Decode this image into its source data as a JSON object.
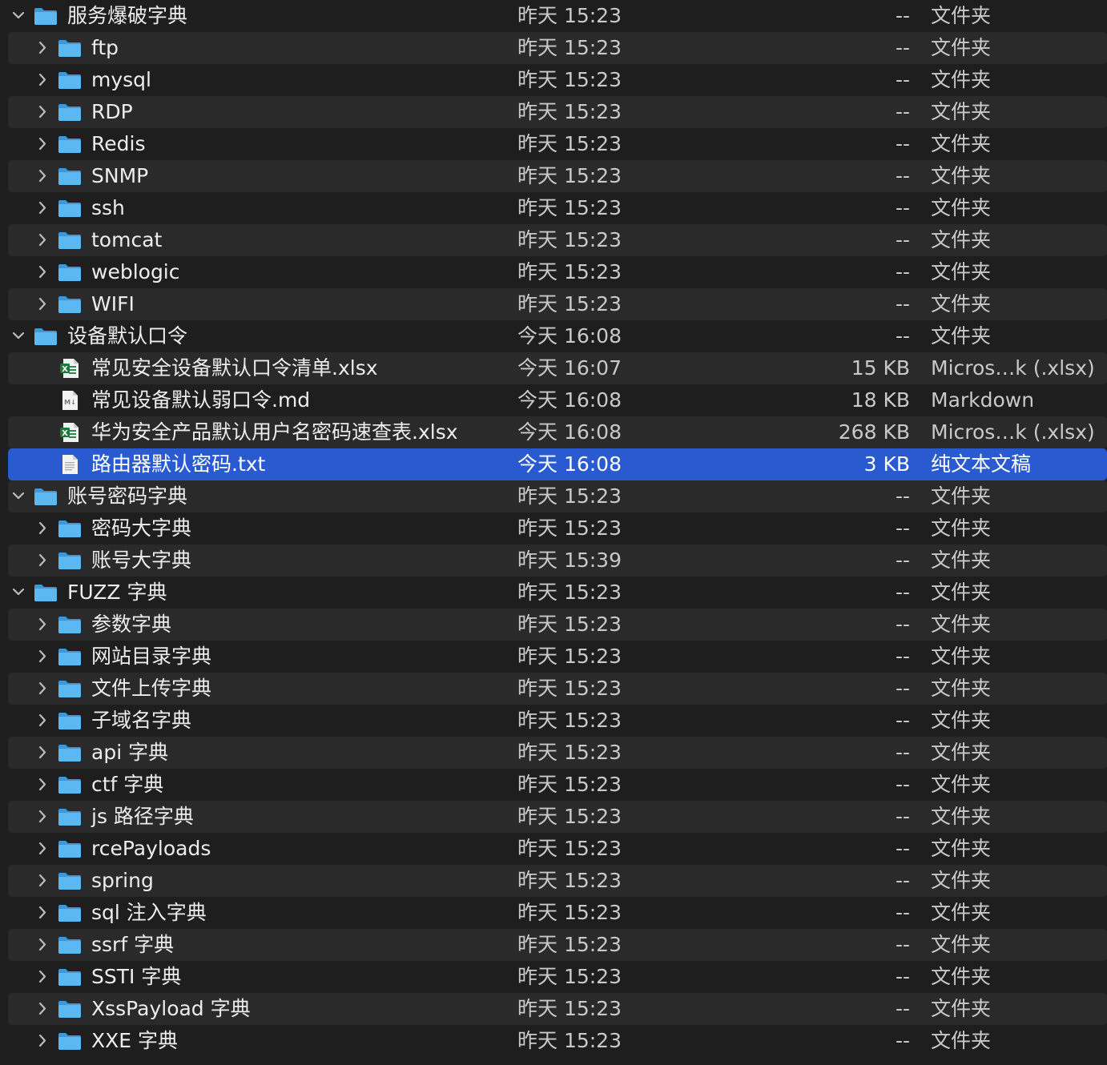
{
  "colors": {
    "background": "#1e1e1e",
    "stripe": "#2a2a2a",
    "selection": "#2a5ad0",
    "folder": "#5cb8f0",
    "excel_green": "#1e7a3c"
  },
  "rows": [
    {
      "name": "服务爆破字典",
      "date": "昨天 15:23",
      "size": "--",
      "kind": "文件夹",
      "depth": 0,
      "type": "folder",
      "expanded": true
    },
    {
      "name": "ftp",
      "date": "昨天 15:23",
      "size": "--",
      "kind": "文件夹",
      "depth": 1,
      "type": "folder",
      "expanded": false
    },
    {
      "name": "mysql",
      "date": "昨天 15:23",
      "size": "--",
      "kind": "文件夹",
      "depth": 1,
      "type": "folder",
      "expanded": false
    },
    {
      "name": "RDP",
      "date": "昨天 15:23",
      "size": "--",
      "kind": "文件夹",
      "depth": 1,
      "type": "folder",
      "expanded": false
    },
    {
      "name": "Redis",
      "date": "昨天 15:23",
      "size": "--",
      "kind": "文件夹",
      "depth": 1,
      "type": "folder",
      "expanded": false
    },
    {
      "name": "SNMP",
      "date": "昨天 15:23",
      "size": "--",
      "kind": "文件夹",
      "depth": 1,
      "type": "folder",
      "expanded": false
    },
    {
      "name": "ssh",
      "date": "昨天 15:23",
      "size": "--",
      "kind": "文件夹",
      "depth": 1,
      "type": "folder",
      "expanded": false
    },
    {
      "name": "tomcat",
      "date": "昨天 15:23",
      "size": "--",
      "kind": "文件夹",
      "depth": 1,
      "type": "folder",
      "expanded": false
    },
    {
      "name": "weblogic",
      "date": "昨天 15:23",
      "size": "--",
      "kind": "文件夹",
      "depth": 1,
      "type": "folder",
      "expanded": false
    },
    {
      "name": "WIFI",
      "date": "昨天 15:23",
      "size": "--",
      "kind": "文件夹",
      "depth": 1,
      "type": "folder",
      "expanded": false
    },
    {
      "name": "设备默认口令",
      "date": "今天 16:08",
      "size": "--",
      "kind": "文件夹",
      "depth": 0,
      "type": "folder",
      "expanded": true
    },
    {
      "name": "常见安全设备默认口令清单.xlsx",
      "date": "今天 16:07",
      "size": "15 KB",
      "kind": "Micros…k (.xlsx)",
      "depth": 1,
      "type": "xlsx"
    },
    {
      "name": "常见设备默认弱口令.md",
      "date": "今天 16:08",
      "size": "18 KB",
      "kind": "Markdown",
      "depth": 1,
      "type": "md"
    },
    {
      "name": "华为安全产品默认用户名密码速查表.xlsx",
      "date": "今天 16:08",
      "size": "268 KB",
      "kind": "Micros…k (.xlsx)",
      "depth": 1,
      "type": "xlsx"
    },
    {
      "name": "路由器默认密码.txt",
      "date": "今天 16:08",
      "size": "3 KB",
      "kind": "纯文本文稿",
      "depth": 1,
      "type": "txt",
      "selected": true
    },
    {
      "name": "账号密码字典",
      "date": "昨天 15:23",
      "size": "--",
      "kind": "文件夹",
      "depth": 0,
      "type": "folder",
      "expanded": true
    },
    {
      "name": "密码大字典",
      "date": "昨天 15:23",
      "size": "--",
      "kind": "文件夹",
      "depth": 1,
      "type": "folder",
      "expanded": false
    },
    {
      "name": "账号大字典",
      "date": "昨天 15:39",
      "size": "--",
      "kind": "文件夹",
      "depth": 1,
      "type": "folder",
      "expanded": false
    },
    {
      "name": "FUZZ 字典",
      "date": "昨天 15:23",
      "size": "--",
      "kind": "文件夹",
      "depth": 0,
      "type": "folder",
      "expanded": true
    },
    {
      "name": "参数字典",
      "date": "昨天 15:23",
      "size": "--",
      "kind": "文件夹",
      "depth": 1,
      "type": "folder",
      "expanded": false
    },
    {
      "name": "网站目录字典",
      "date": "昨天 15:23",
      "size": "--",
      "kind": "文件夹",
      "depth": 1,
      "type": "folder",
      "expanded": false
    },
    {
      "name": "文件上传字典",
      "date": "昨天 15:23",
      "size": "--",
      "kind": "文件夹",
      "depth": 1,
      "type": "folder",
      "expanded": false
    },
    {
      "name": "子域名字典",
      "date": "昨天 15:23",
      "size": "--",
      "kind": "文件夹",
      "depth": 1,
      "type": "folder",
      "expanded": false
    },
    {
      "name": "api 字典",
      "date": "昨天 15:23",
      "size": "--",
      "kind": "文件夹",
      "depth": 1,
      "type": "folder",
      "expanded": false
    },
    {
      "name": "ctf 字典",
      "date": "昨天 15:23",
      "size": "--",
      "kind": "文件夹",
      "depth": 1,
      "type": "folder",
      "expanded": false
    },
    {
      "name": "js 路径字典",
      "date": "昨天 15:23",
      "size": "--",
      "kind": "文件夹",
      "depth": 1,
      "type": "folder",
      "expanded": false
    },
    {
      "name": "rcePayloads",
      "date": "昨天 15:23",
      "size": "--",
      "kind": "文件夹",
      "depth": 1,
      "type": "folder",
      "expanded": false
    },
    {
      "name": "spring",
      "date": "昨天 15:23",
      "size": "--",
      "kind": "文件夹",
      "depth": 1,
      "type": "folder",
      "expanded": false
    },
    {
      "name": "sql 注入字典",
      "date": "昨天 15:23",
      "size": "--",
      "kind": "文件夹",
      "depth": 1,
      "type": "folder",
      "expanded": false
    },
    {
      "name": "ssrf 字典",
      "date": "昨天 15:23",
      "size": "--",
      "kind": "文件夹",
      "depth": 1,
      "type": "folder",
      "expanded": false
    },
    {
      "name": "SSTI 字典",
      "date": "昨天 15:23",
      "size": "--",
      "kind": "文件夹",
      "depth": 1,
      "type": "folder",
      "expanded": false
    },
    {
      "name": "XssPayload 字典",
      "date": "昨天 15:23",
      "size": "--",
      "kind": "文件夹",
      "depth": 1,
      "type": "folder",
      "expanded": false
    },
    {
      "name": "XXE 字典",
      "date": "昨天 15:23",
      "size": "--",
      "kind": "文件夹",
      "depth": 1,
      "type": "folder",
      "expanded": false
    }
  ]
}
